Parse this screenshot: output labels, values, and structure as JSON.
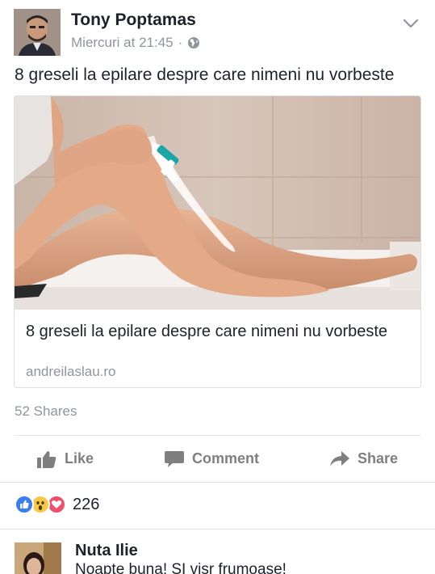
{
  "post": {
    "author": "Tony Poptamas",
    "timestamp": "Miercuri at 21:45",
    "separator": "·",
    "privacy_icon": "globe-icon",
    "menu_icon": "chevron-down-icon",
    "status_text": "8 greseli la epilare despre care nimeni nu vorbeste"
  },
  "link": {
    "title": "8 greseli la epilare despre care nimeni nu vorbeste",
    "domain": "andreilaslau.ro"
  },
  "shares": "52 Shares",
  "actions": {
    "like": "Like",
    "comment": "Comment",
    "share": "Share"
  },
  "reactions": {
    "icons": [
      "like-reaction-icon",
      "wow-reaction-icon",
      "love-reaction-icon"
    ],
    "count": "226"
  },
  "comment": {
    "author": "Nuta Ilie",
    "text": "Noapte buna! SI visr frumoase!"
  },
  "colors": {
    "text": "#1d2129",
    "muted": "#90949c",
    "action": "#7f7f7f",
    "like_blue": "#3b7cf0",
    "love_red": "#f0506e",
    "wow_yellow": "#f7c944"
  }
}
